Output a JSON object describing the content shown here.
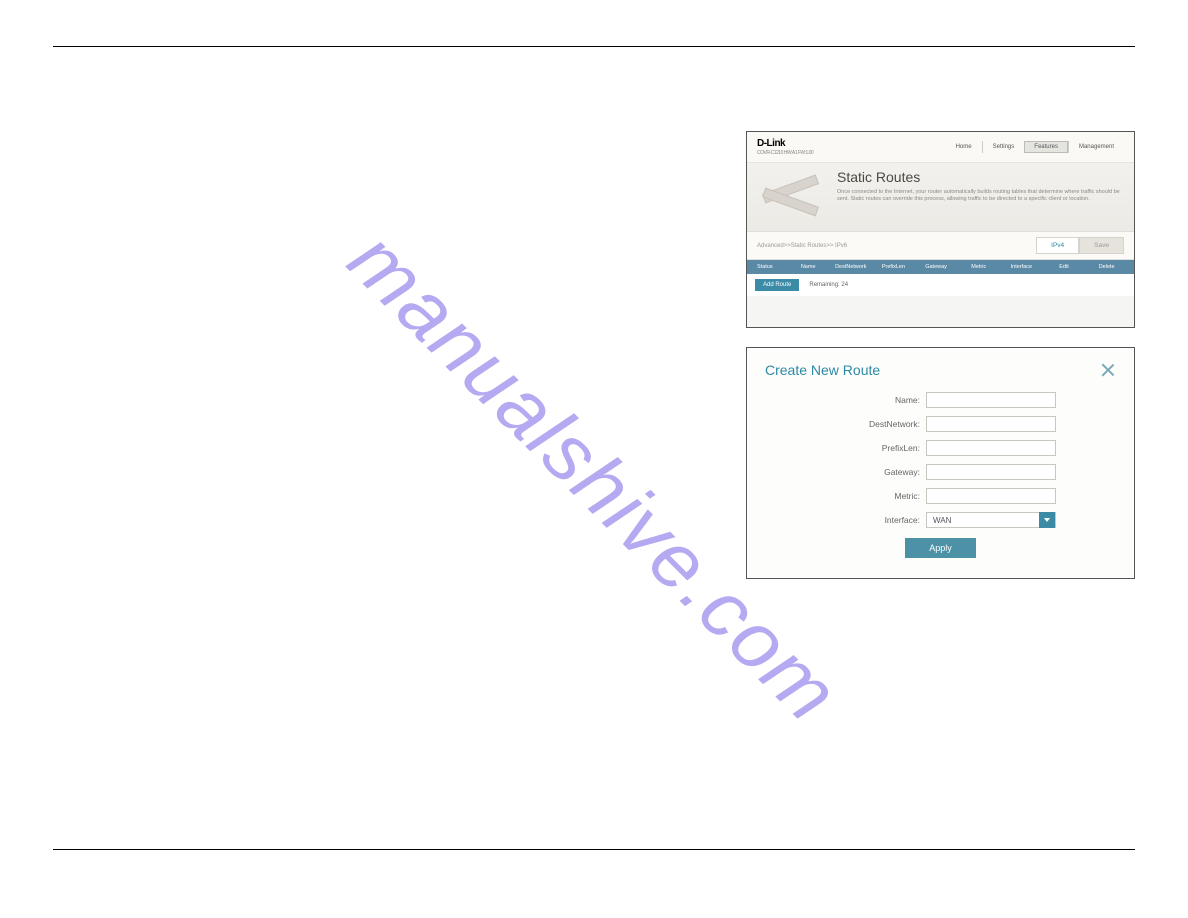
{
  "watermark": "manualshive.com",
  "shot1": {
    "logo_main": "D-Link",
    "logo_sub": "COVR-C1210 HW:A1 FW:1.00",
    "nav": {
      "home": "Home",
      "settings": "Settings",
      "features": "Features",
      "management": "Management"
    },
    "hero_title": "Static Routes",
    "hero_desc": "Once connected to the Internet, your router automatically builds routing tables that determine where traffic should be sent. Static routes can override this process, allowing traffic to be directed to a specific client or location.",
    "breadcrumb": "Advanced>>Static Routes>> IPv6",
    "ipv4_btn": "IPv4",
    "save_btn": "Save",
    "cols": {
      "status": "Status",
      "name": "Name",
      "dest": "DestNetwork",
      "prefix": "PrefixLen",
      "gateway": "Gateway",
      "metric": "Metric",
      "iface": "Interface",
      "edit": "Edit",
      "del": "Delete"
    },
    "add_btn": "Add Route",
    "remaining": "Remaining: 24"
  },
  "shot2": {
    "title": "Create New Route",
    "labels": {
      "name": "Name:",
      "dest": "DestNetwork:",
      "prefix": "PrefixLen:",
      "gateway": "Gateway:",
      "metric": "Metric:",
      "iface": "Interface:"
    },
    "iface_value": "WAN",
    "apply": "Apply"
  }
}
